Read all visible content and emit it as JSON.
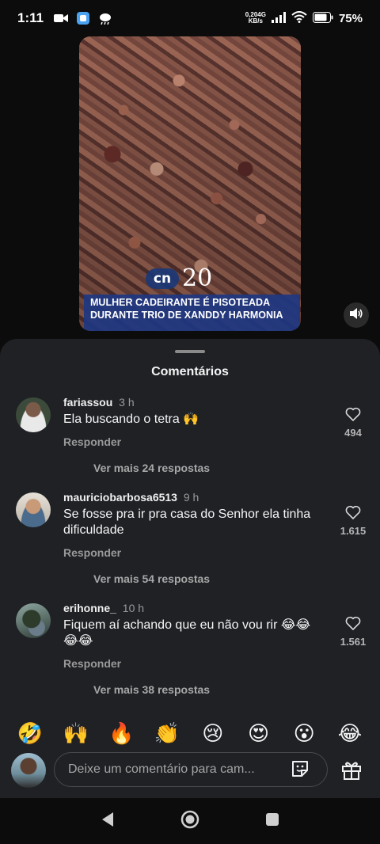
{
  "status_bar": {
    "time": "1:11",
    "net_speed_value": "0,20",
    "net_speed_unit": "KB/s",
    "network": "4G",
    "battery": "75%",
    "icons": [
      "video-camera-icon",
      "app-icon",
      "weather-icon",
      "signal-icon",
      "wifi-icon",
      "battery-icon"
    ]
  },
  "video": {
    "logo_text": "cn",
    "logo_number": "20",
    "headline": "MULHER CADEIRANTE É PISOTEADA DURANTE TRIO DE XANDDY HARMONIA",
    "mute_icon": "speaker-icon"
  },
  "comments_sheet": {
    "title": "Comentários",
    "comments": [
      {
        "username": "fariassou",
        "time": "3 h",
        "text": "Ela buscando o tetra 🙌",
        "reply_label": "Responder",
        "likes": "494",
        "more_replies": "Ver mais 24 respostas"
      },
      {
        "username": "mauriciobarbosa6513",
        "time": "9 h",
        "text": "Se fosse pra ir pra casa do Senhor ela tinha dificuldade",
        "reply_label": "Responder",
        "likes": "1.615",
        "more_replies": "Ver mais 54 respostas"
      },
      {
        "username": "erihonne_",
        "time": "10 h",
        "text": "Fiquem aí achando que eu não vou rir 😂😂😂😂",
        "reply_label": "Responder",
        "likes": "1.561",
        "more_replies": "Ver mais 38 respostas"
      }
    ]
  },
  "reactions": [
    "🤣",
    "🙌",
    "🔥",
    "👏",
    "😢",
    "😍",
    "😮",
    "😂"
  ],
  "composer": {
    "placeholder": "Deixe um comentário para cam..."
  },
  "colors": {
    "sheet_bg": "#1f2125",
    "page_bg": "#0c0c0c",
    "headline_bg": "#1e3782"
  }
}
